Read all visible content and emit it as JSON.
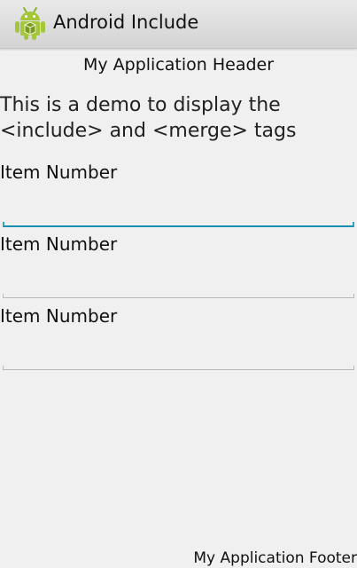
{
  "action_bar": {
    "icon": "android-robot-icon",
    "title": "Android Include"
  },
  "content": {
    "header": "My Application Header",
    "demo_text": "This is a demo to display the <include> and <merge> tags",
    "items": [
      {
        "label": "Item Number",
        "value": "",
        "focused": true
      },
      {
        "label": "Item Number",
        "value": "",
        "focused": false
      },
      {
        "label": "Item Number",
        "value": "",
        "focused": false
      }
    ],
    "footer": "My Application Footer"
  },
  "colors": {
    "focus_accent": "#33a3c4",
    "icon_green": "#a4c639"
  }
}
